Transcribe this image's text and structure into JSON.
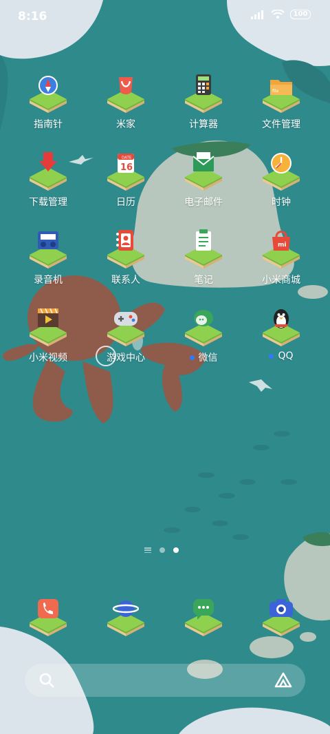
{
  "status_bar": {
    "time": "8:16",
    "battery": "100"
  },
  "apps": [
    {
      "label": "指南针",
      "icon": "compass-icon",
      "dot": false
    },
    {
      "label": "米家",
      "icon": "mijia-icon",
      "dot": false
    },
    {
      "label": "计算器",
      "icon": "calculator-icon",
      "dot": false
    },
    {
      "label": "文件管理",
      "icon": "folder-icon",
      "dot": false
    },
    {
      "label": "下载管理",
      "icon": "download-icon",
      "dot": false
    },
    {
      "label": "日历",
      "icon": "calendar-icon",
      "dot": false,
      "calendar_day": "16",
      "calendar_header": "DATE"
    },
    {
      "label": "电子邮件",
      "icon": "email-icon",
      "dot": false
    },
    {
      "label": "时钟",
      "icon": "clock-icon",
      "dot": false
    },
    {
      "label": "录音机",
      "icon": "recorder-icon",
      "dot": false
    },
    {
      "label": "联系人",
      "icon": "contacts-icon",
      "dot": false
    },
    {
      "label": "笔记",
      "icon": "notes-icon",
      "dot": false
    },
    {
      "label": "小米商城",
      "icon": "mi-store-icon",
      "dot": false,
      "badge": "mi"
    },
    {
      "label": "小米视频",
      "icon": "video-icon",
      "dot": false
    },
    {
      "label": "游戏中心",
      "icon": "gamepad-icon",
      "dot": false
    },
    {
      "label": "微信",
      "icon": "wechat-icon",
      "dot": true
    },
    {
      "label": "QQ",
      "icon": "qq-penguin-icon",
      "dot": true
    }
  ],
  "dock": [
    {
      "icon": "phone-icon"
    },
    {
      "icon": "browser-planet-icon"
    },
    {
      "icon": "messages-icon"
    },
    {
      "icon": "camera-icon"
    }
  ],
  "pager": {
    "pages": 2,
    "active": 2
  },
  "search": {
    "left_icon": "search-icon",
    "right_icon": "assistant-icon"
  },
  "folder_icon_text": "file",
  "colors": {
    "wallpaper": "#2f8a8c",
    "grass": "#8fd14f",
    "soil": "#e8c98f",
    "octopus": "#8f5b4a",
    "island": "#b7c7bd"
  }
}
